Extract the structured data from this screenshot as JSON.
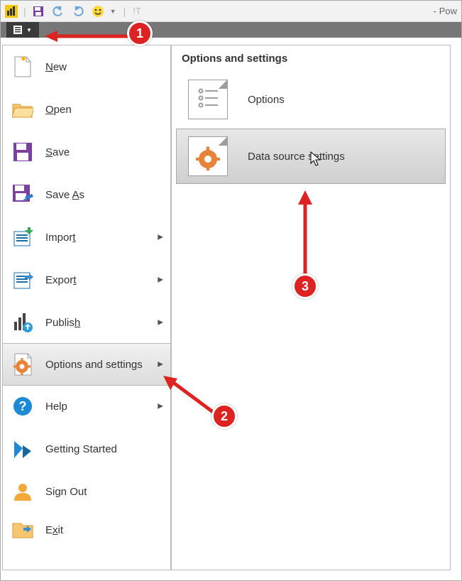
{
  "window": {
    "title_suffix": "- Pow"
  },
  "file_menu": {
    "items": [
      {
        "key": "new",
        "label_html": "<u class='ak'>N</u>ew"
      },
      {
        "key": "open",
        "label_html": "<u class='ak'>O</u>pen"
      },
      {
        "key": "save",
        "label_html": "<u class='ak'>S</u>ave"
      },
      {
        "key": "saveas",
        "label_html": "Save <u class='ak'>A</u>s"
      },
      {
        "key": "import",
        "label_html": "Impor<u class='ak'>t</u>",
        "has_sub": true
      },
      {
        "key": "export",
        "label_html": "Expor<u class='ak'>t</u>",
        "has_sub": true
      },
      {
        "key": "publish",
        "label_html": "Publis<u class='ak'>h</u>",
        "has_sub": true
      },
      {
        "key": "optset",
        "label_html": "Options and settings",
        "has_sub": true,
        "selected": true
      },
      {
        "key": "help",
        "label_html": "Help",
        "has_sub": true
      },
      {
        "key": "getst",
        "label_html": "Getting Started"
      },
      {
        "key": "signout",
        "label_html": "Sign Out"
      },
      {
        "key": "exit",
        "label_html": "E<u class='ak'>x</u>it"
      }
    ]
  },
  "submenu": {
    "title": "Options and settings",
    "items": [
      {
        "key": "options",
        "label": "Options"
      },
      {
        "key": "dss",
        "label": "Data source settings",
        "hover": true
      }
    ]
  },
  "annotations": {
    "1": "1",
    "2": "2",
    "3": "3"
  }
}
